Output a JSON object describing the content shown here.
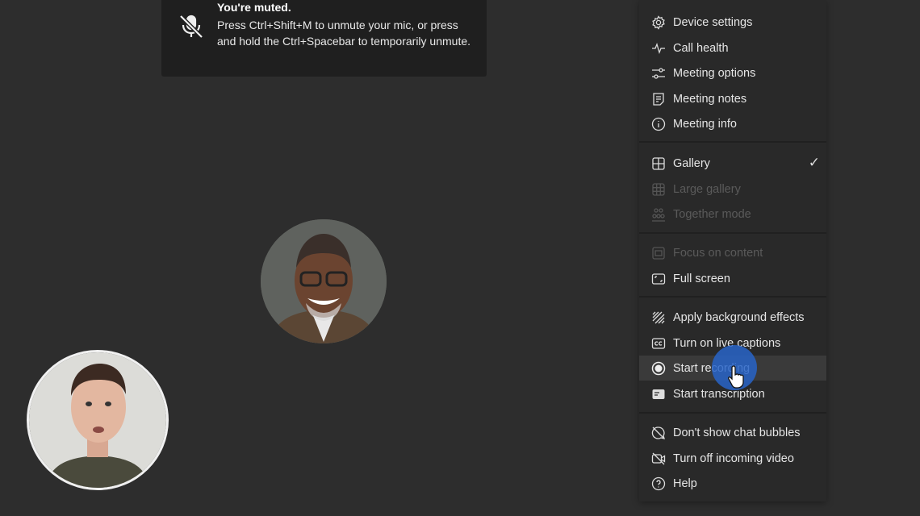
{
  "toast": {
    "title": "You're muted.",
    "body": "Press Ctrl+Shift+M to unmute your mic, or press and hold the Ctrl+Spacebar to temporarily unmute.",
    "icon": "mic-off-icon"
  },
  "menu": {
    "groups": [
      [
        {
          "label": "Device settings",
          "icon": "gear-icon"
        },
        {
          "label": "Call health",
          "icon": "pulse-icon"
        },
        {
          "label": "Meeting options",
          "icon": "sliders-icon"
        },
        {
          "label": "Meeting notes",
          "icon": "notes-icon"
        },
        {
          "label": "Meeting info",
          "icon": "info-icon"
        }
      ],
      [
        {
          "label": "Gallery",
          "icon": "grid-icon",
          "checked": true
        },
        {
          "label": "Large gallery",
          "icon": "large-grid-icon",
          "disabled": true
        },
        {
          "label": "Together mode",
          "icon": "together-icon",
          "disabled": true
        }
      ],
      [
        {
          "label": "Focus on content",
          "icon": "focus-icon",
          "disabled": true
        },
        {
          "label": "Full screen",
          "icon": "fullscreen-icon"
        }
      ],
      [
        {
          "label": "Apply background effects",
          "icon": "background-effects-icon"
        },
        {
          "label": "Turn on live captions",
          "icon": "cc-icon"
        },
        {
          "label": "Start recording",
          "icon": "record-icon",
          "hovered": true
        },
        {
          "label": "Start transcription",
          "icon": "transcript-icon"
        }
      ],
      [
        {
          "label": "Don't show chat bubbles",
          "icon": "chat-off-icon"
        },
        {
          "label": "Turn off incoming video",
          "icon": "video-off-icon"
        },
        {
          "label": "Help",
          "icon": "help-icon"
        }
      ]
    ]
  },
  "colors": {
    "background": "#2d2d2d",
    "menu": "#292929",
    "toast": "#1f1f1f",
    "click_indicator": "#2864c8"
  }
}
